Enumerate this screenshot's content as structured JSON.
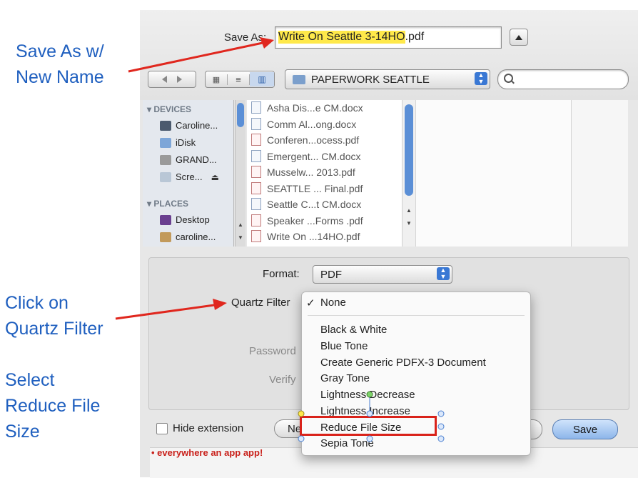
{
  "annotations": {
    "save_as_line1": "Save As w/",
    "save_as_line2": "New Name",
    "click_line1": "Click on",
    "click_line2": "Quartz Filter",
    "select_line1": "Select",
    "select_line2": "Reduce File",
    "select_line3": "Size"
  },
  "dialog": {
    "save_as_label": "Save As:",
    "filename_selected": "Write On Seattle 3-14HO",
    "filename_ext": ".pdf",
    "folder_name": "PAPERWORK SEATTLE",
    "search_placeholder": ""
  },
  "sidebar": {
    "devices_header": "DEVICES",
    "devices": [
      "Caroline...",
      "iDisk",
      "GRAND...",
      "Scre..."
    ],
    "places_header": "PLACES",
    "places": [
      "Desktop",
      "caroline..."
    ]
  },
  "files": [
    {
      "name": "Asha Dis...e CM.docx",
      "type": "docx"
    },
    {
      "name": "Comm Al...ong.docx",
      "type": "docx"
    },
    {
      "name": "Conferen...ocess.pdf",
      "type": "pdf"
    },
    {
      "name": "Emergent... CM.docx",
      "type": "docx"
    },
    {
      "name": "Musselw... 2013.pdf",
      "type": "pdf"
    },
    {
      "name": "SEATTLE ... Final.pdf",
      "type": "pdf"
    },
    {
      "name": "Seattle C...t CM.docx",
      "type": "docx"
    },
    {
      "name": "Speaker ...Forms .pdf",
      "type": "pdf"
    },
    {
      "name": "Write On ...14HO.pdf",
      "type": "pdf"
    }
  ],
  "options": {
    "format_label": "Format:",
    "format_value": "PDF",
    "quartz_label": "Quartz Filter",
    "password_label": "Password",
    "verify_label": "Verify"
  },
  "menu": {
    "checkmark": "✓",
    "items": [
      "None",
      "Black & White",
      "Blue Tone",
      "Create Generic PDFX-3 Document",
      "Gray Tone",
      "Lightness Decrease",
      "Lightness Increase",
      "Reduce File Size",
      "Sepia Tone"
    ]
  },
  "footer": {
    "hide_extension": "Hide extension",
    "new_folder_partial": "Ne",
    "save_button": "Save"
  },
  "background_text": "• everywhere an app app!",
  "colors": {
    "annotation_blue": "#1f5fbf",
    "arrow_red": "#e0271e",
    "highlight_yellow": "#ffe94a",
    "selection_box": "#d9221a",
    "save_button_blue": "#9cc2f0"
  }
}
